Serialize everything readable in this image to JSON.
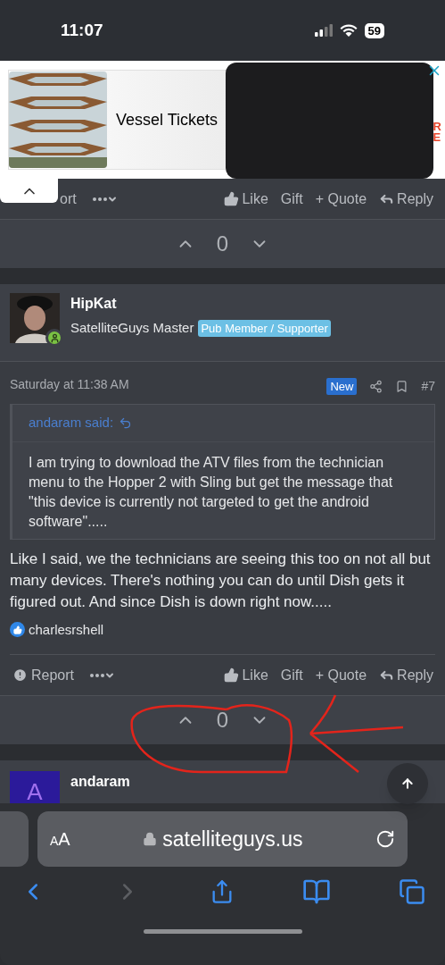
{
  "status_bar": {
    "time": "11:07",
    "battery": "59"
  },
  "ad": {
    "title": "Vessel Tickets",
    "fragments": [
      "R",
      "E"
    ]
  },
  "posts": [
    {
      "kind": "partial",
      "actions": {
        "report": "ort",
        "like": "Like",
        "gift": "Gift",
        "quote": "+ Quote",
        "reply": "Reply"
      },
      "votes": "0"
    },
    {
      "kind": "full",
      "author": "HipKat",
      "rank": "SatelliteGuys Master",
      "badge": "Pub Member / Supporter",
      "date": "Saturday at 11:38 AM",
      "new_badge": "New",
      "number": "#7",
      "quote": {
        "author": "andaram said:",
        "text": "I am trying to download the ATV files from the technician menu to the Hopper 2 with Sling but get the message that \"this device is currently not targeted to get the android software\"....."
      },
      "body": "Like I said, we the technicians are seeing this too on not all but many devices. There's nothing you can do until Dish gets it figured out. And since Dish is down right now.....",
      "reactions": [
        "charlesrshell"
      ],
      "actions": {
        "report": "Report",
        "like": "Like",
        "gift": "Gift",
        "quote": "+ Quote",
        "reply": "Reply"
      },
      "votes": "0",
      "annotated": true
    },
    {
      "kind": "cut",
      "author": "andaram",
      "avatar_letter": "A"
    }
  ],
  "browser": {
    "text_size": "AA",
    "url": "satelliteguys.us"
  }
}
